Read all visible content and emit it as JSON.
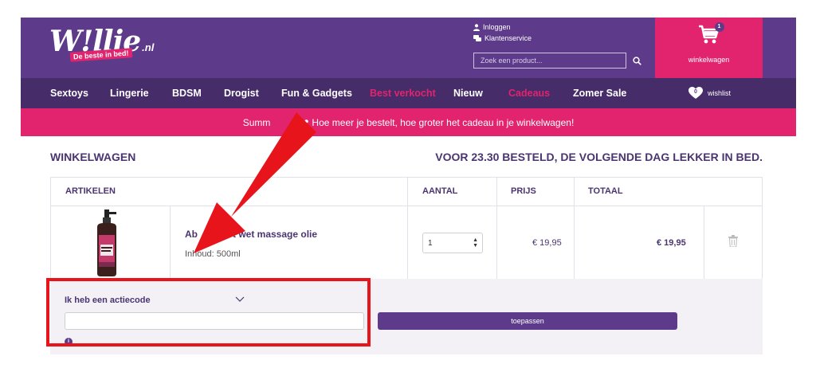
{
  "brand": {
    "name": "W!llie",
    "suffix": ".nl",
    "tagline": "De beste in bed!"
  },
  "top_links": [
    {
      "label": "Inloggen",
      "icon": "user-icon"
    },
    {
      "label": "Klantenservice",
      "icon": "chat-icon"
    }
  ],
  "search": {
    "placeholder": "Zoek een product..."
  },
  "cart": {
    "label": "winkelwagen",
    "count": "1"
  },
  "nav": {
    "items": [
      {
        "label": "Sextoys"
      },
      {
        "label": "Lingerie"
      },
      {
        "label": "BDSM"
      },
      {
        "label": "Drogist"
      },
      {
        "label": "Fun & Gadgets"
      },
      {
        "label": "Best verkocht"
      },
      {
        "label": "Nieuw"
      },
      {
        "label": "Cadeaus"
      },
      {
        "label": "Zomer Sale"
      }
    ],
    "wishlist": {
      "label": "wishlist",
      "count": "0"
    }
  },
  "promo_banner": {
    "left": "Summ",
    "right": "Hoe meer je bestelt, hoe groter het cadeau in je winkelwagen!"
  },
  "page": {
    "title": "WINKELWAGEN",
    "delivery_message": "VOOR 23.30 BESTELD, DE VOLGENDE DAG LEKKER IN BED."
  },
  "table": {
    "headers": {
      "articles": "ARTIKELEN",
      "quantity": "AANTAL",
      "price": "PRIJS",
      "total": "TOTAAL"
    },
    "rows": [
      {
        "name_start": "Ab",
        "name_end": "t wet massage olie",
        "content": "Inhoud: 500ml",
        "quantity": "1",
        "price": "€ 19,95",
        "total": "€ 19,95"
      }
    ]
  },
  "action_code": {
    "toggle_label": "Ik heb een actiecode",
    "input_value": "",
    "apply_label": "toepassen"
  },
  "colors": {
    "purple": "#5e3b8a",
    "dark_purple": "#462c69",
    "pink": "#e2236d",
    "annotation_red": "#e8141c"
  }
}
